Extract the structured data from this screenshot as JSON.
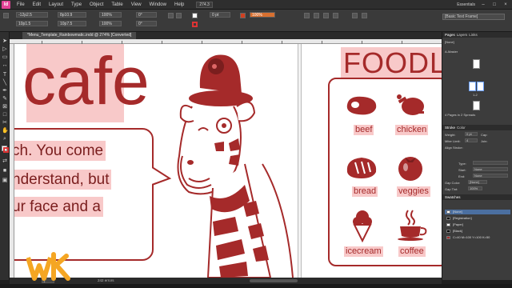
{
  "app": {
    "logo_text": "Id"
  },
  "menu": {
    "items": [
      "File",
      "Edit",
      "Layout",
      "Type",
      "Object",
      "Table",
      "View",
      "Window",
      "Help"
    ],
    "zoom": "274.3",
    "workspace": "Essentials",
    "window_buttons": [
      "–",
      "□",
      "×"
    ]
  },
  "control": {
    "x": "-12p2.5",
    "y": "10p1.5",
    "w": "8p10.9",
    "h": "10p7.5",
    "scale_x": "100%",
    "scale_y": "100%",
    "rotate": "0°",
    "shear": "0°",
    "stroke_weight": "0 pt",
    "opacity": "100%",
    "style_field": "[Basic Text Frame]"
  },
  "document": {
    "tab_title": "*Menu_Template_Rainbowmatic.indd @ 274% [Converted]"
  },
  "canvas": {
    "cafe_title": "cafe",
    "body_lines": [
      "ch. You come",
      "nderstand, but",
      "ur face and a"
    ],
    "menu_title": "FOODL",
    "foods": [
      {
        "label": "beef",
        "icon": "steak-icon"
      },
      {
        "label": "chicken",
        "icon": "chicken-icon"
      },
      {
        "label": "bread",
        "icon": "bread-icon"
      },
      {
        "label": "veggies",
        "icon": "tomato-icon"
      },
      {
        "label": "icecream",
        "icon": "icecream-icon"
      },
      {
        "label": "coffee",
        "icon": "coffee-icon"
      }
    ],
    "brand_color": "#a52a2a",
    "highlight_color": "#f8c9c9"
  },
  "panels": {
    "pages_tabs": [
      "Pages",
      "Layers",
      "Links"
    ],
    "none_label": "[None]",
    "master_label": "A-Master",
    "page_number": "1-2",
    "pages_status": "4 Pages in 2 Spreads",
    "stroke_tabs": [
      "Stroke",
      "Color"
    ],
    "stroke_labels": [
      "Weight:",
      "Miter Limit:",
      "Align Stroke:",
      "Type:",
      "Start:",
      "End:",
      "Gap Color:",
      "Gap Tint:"
    ],
    "stroke_values": [
      "0 pt",
      "4",
      "",
      "",
      "None",
      "None",
      "[None]",
      "100%"
    ],
    "cap_label": "Cap:",
    "join_label": "Join:",
    "swatches_tab": "Swatches",
    "swatches": [
      {
        "name": "[None]",
        "color": "#ffffff",
        "selected": true
      },
      {
        "name": "[Registration]",
        "color": "#000000",
        "selected": false
      },
      {
        "name": "[Paper]",
        "color": "#ffffff",
        "selected": false
      },
      {
        "name": "[Black]",
        "color": "#000000",
        "selected": false
      },
      {
        "name": "C=40 M=100 Y=100 K=50",
        "color": "#a52a2a",
        "selected": false
      }
    ]
  },
  "status": {
    "page": "1",
    "errors": "242 errors"
  }
}
